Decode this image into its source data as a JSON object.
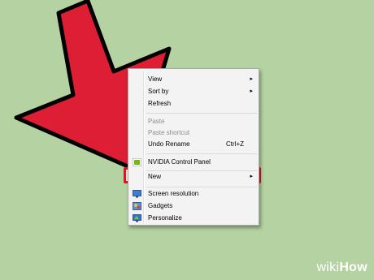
{
  "colors": {
    "background": "#b5d3a2",
    "arrow": "#de1e34",
    "arrow_outline": "#000000",
    "highlight": "#e4101b"
  },
  "menu": {
    "items": [
      {
        "label": "View",
        "submenu": true
      },
      {
        "label": "Sort by",
        "submenu": true
      },
      {
        "label": "Refresh"
      },
      {
        "label": "Paste",
        "disabled": true
      },
      {
        "label": "Paste shortcut",
        "disabled": true
      },
      {
        "label": "Undo Rename",
        "shortcut": "Ctrl+Z"
      },
      {
        "label": "NVIDIA Control Panel",
        "icon": "nvidia-icon"
      },
      {
        "label": "New",
        "submenu": true,
        "highlighted": true
      },
      {
        "label": "Screen resolution",
        "icon": "screen-resolution-icon"
      },
      {
        "label": "Gadgets",
        "icon": "gadgets-icon"
      },
      {
        "label": "Personalize",
        "icon": "personalize-icon"
      }
    ],
    "submenu_glyph": "▸"
  },
  "brand": {
    "wiki": "wiki",
    "how": "How"
  }
}
